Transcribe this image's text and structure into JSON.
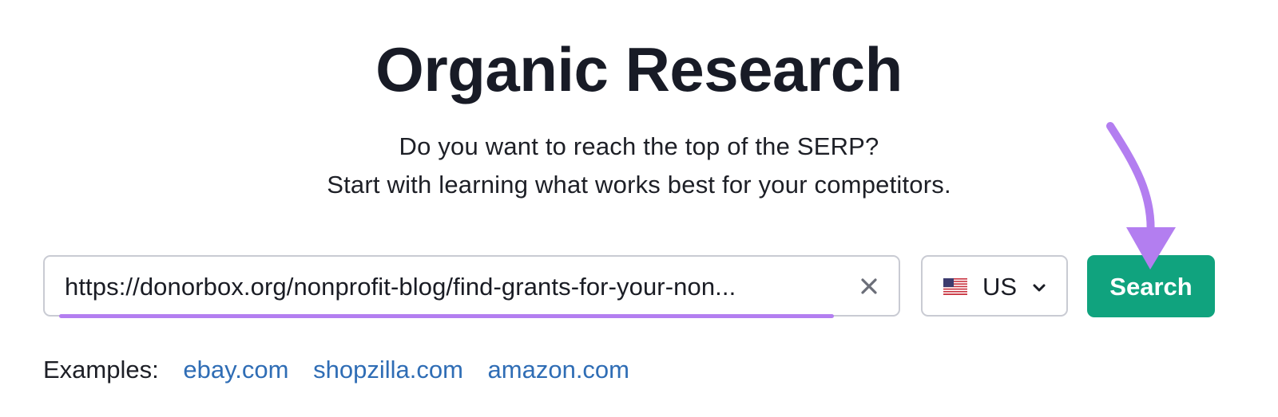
{
  "header": {
    "title": "Organic Research",
    "subtitle_line1": "Do you want to reach the top of the SERP?",
    "subtitle_line2": "Start with learning what works best for your competitors."
  },
  "search": {
    "value": "https://donorbox.org/nonprofit-blog/find-grants-for-your-non...",
    "clear_icon": "close-icon"
  },
  "country": {
    "flag_icon": "us-flag-icon",
    "label": "US",
    "dropdown_icon": "chevron-down-icon"
  },
  "search_button": {
    "label": "Search"
  },
  "examples": {
    "label": "Examples:",
    "links": [
      "ebay.com",
      "shopzilla.com",
      "amazon.com"
    ]
  },
  "colors": {
    "accent_green": "#10a37e",
    "highlight_purple": "#b37ef0",
    "link_blue": "#2f6db5"
  }
}
